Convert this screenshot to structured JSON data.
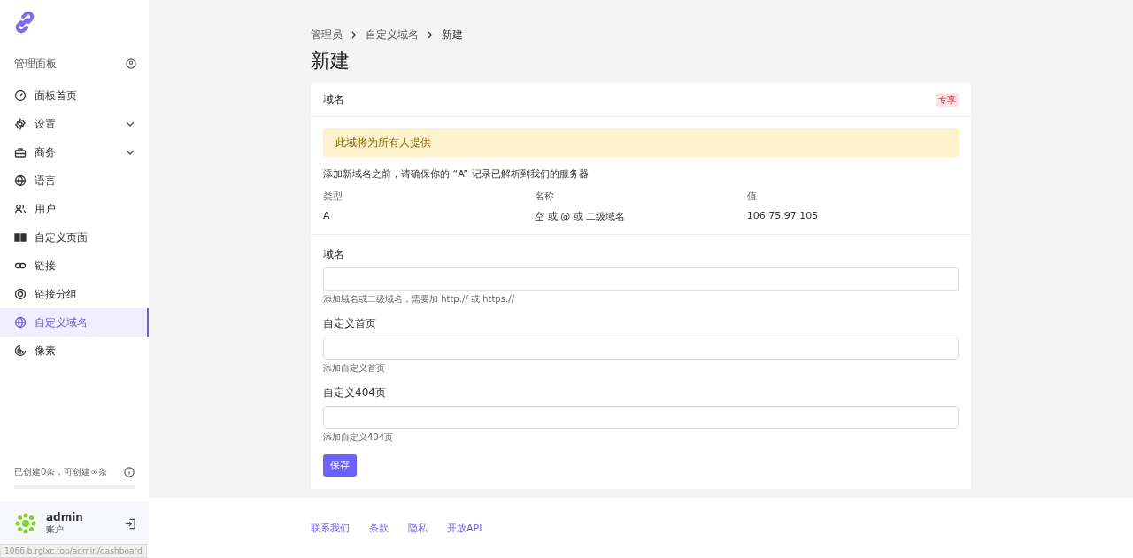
{
  "sidebar": {
    "section_title": "管理面板",
    "items": [
      {
        "label": "面板首页",
        "expandable": false,
        "selected": false
      },
      {
        "label": "设置",
        "expandable": true,
        "selected": false
      },
      {
        "label": "商务",
        "expandable": true,
        "selected": false
      },
      {
        "label": "语言",
        "expandable": false,
        "selected": false
      },
      {
        "label": "用户",
        "expandable": false,
        "selected": false
      },
      {
        "label": "自定义页面",
        "expandable": false,
        "selected": false
      },
      {
        "label": "链接",
        "expandable": false,
        "selected": false
      },
      {
        "label": "链接分组",
        "expandable": false,
        "selected": false
      },
      {
        "label": "自定义域名",
        "expandable": false,
        "selected": true
      },
      {
        "label": "像素",
        "expandable": false,
        "selected": false
      }
    ],
    "usage": {
      "text": "已创建0条，可创建∞条"
    },
    "user": {
      "name": "admin",
      "role": "账户"
    }
  },
  "status_url": "1066.b.rglxc.top/admin/dashboard",
  "breadcrumb": [
    "管理员",
    "自定义域名",
    "新建"
  ],
  "page_title": "新建",
  "card": {
    "title": "域名",
    "badge": "专享",
    "alert": "此域将为所有人提供",
    "note": "添加新域名之前，请确保你的 “A” 记录已解析到我们的服务器",
    "dns_columns": [
      "类型",
      "名称",
      "值"
    ],
    "dns_row": [
      "A",
      "空 或 @ 或 二级域名",
      "106.75.97.105"
    ],
    "fields": [
      {
        "label": "域名",
        "help": "添加域名或二级域名，需要加 http:// 或 https://"
      },
      {
        "label": "自定义首页",
        "help": "添加自定义首页"
      },
      {
        "label": "自定义404页",
        "help": "添加自定义404页"
      }
    ],
    "submit": "保存"
  },
  "footer_links": [
    "联系我们",
    "条款",
    "隐私",
    "开放API"
  ]
}
